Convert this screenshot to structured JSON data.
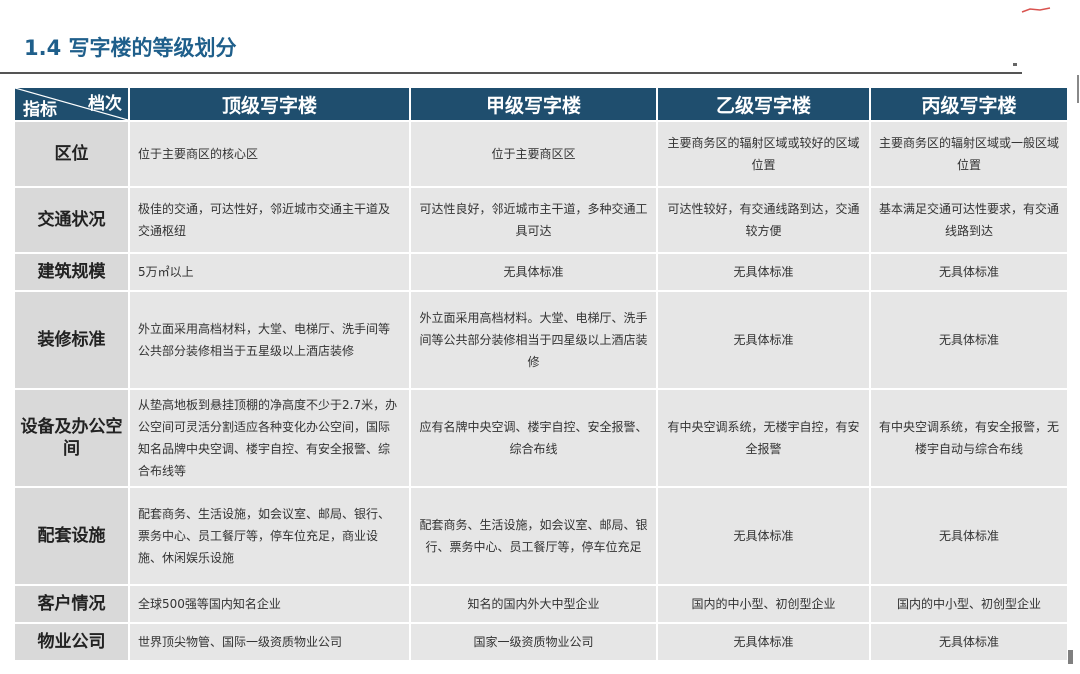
{
  "title": "1.4 写字楼的等级划分",
  "table": {
    "corner_top": "档次",
    "corner_bottom": "指标",
    "columns": [
      "顶级写字楼",
      "甲级写字楼",
      "乙级写字楼",
      "丙级写字楼"
    ],
    "rows": [
      {
        "label": "区位",
        "cells": [
          "位于主要商区的核心区",
          "位于主要商区区",
          "主要商务区的辐射区域或较好的区域位置",
          "主要商务区的辐射区域或一般区域位置"
        ]
      },
      {
        "label": "交通状况",
        "cells": [
          "极佳的交通，可达性好，邻近城市交通主干道及交通枢纽",
          "可达性良好，邻近城市主干道，多种交通工具可达",
          "可达性较好，有交通线路到达，交通较方便",
          "基本满足交通可达性要求，有交通线路到达"
        ]
      },
      {
        "label": "建筑规模",
        "cells": [
          "5万㎡以上",
          "无具体标准",
          "无具体标准",
          "无具体标准"
        ]
      },
      {
        "label": "装修标准",
        "cells": [
          "外立面采用高档材料，大堂、电梯厅、洗手间等公共部分装修相当于五星级以上酒店装修",
          "外立面采用高档材料。大堂、电梯厅、洗手间等公共部分装修相当于四星级以上酒店装修",
          "无具体标准",
          "无具体标准"
        ]
      },
      {
        "label": "设备及办公空间",
        "cells": [
          "从垫高地板到悬挂顶棚的净高度不少于2.7米，办公空间可灵活分割适应各种变化办公空间，国际知名品牌中央空调、楼宇自控、有安全报警、综合布线等",
          "应有名牌中央空调、楼宇自控、安全报警、综合布线",
          "有中央空调系统，无楼宇自控，有安全报警",
          "有中央空调系统，有安全报警，无楼宇自动与综合布线"
        ]
      },
      {
        "label": "配套设施",
        "cells": [
          "配套商务、生活设施，如会议室、邮局、银行、票务中心、员工餐厅等，停车位充足，商业设施、休闲娱乐设施",
          "配套商务、生活设施，如会议室、邮局、银行、票务中心、员工餐厅等，停车位充足",
          "无具体标准",
          "无具体标准"
        ]
      },
      {
        "label": "客户情况",
        "cells": [
          "全球500强等国内知名企业",
          "知名的国内外大中型企业",
          "国内的中小型、初创型企业",
          "国内的中小型、初创型企业"
        ]
      },
      {
        "label": "物业公司",
        "cells": [
          "世界顶尖物管、国际一级资质物业公司",
          "国家一级资质物业公司",
          "无具体标准",
          "无具体标准"
        ]
      }
    ]
  },
  "colors": {
    "header_bg": "#1f4e6e",
    "title": "#1f5f8b",
    "cell_bg": "#e6e6e6",
    "rowhead_bg": "#d9d9d9"
  }
}
